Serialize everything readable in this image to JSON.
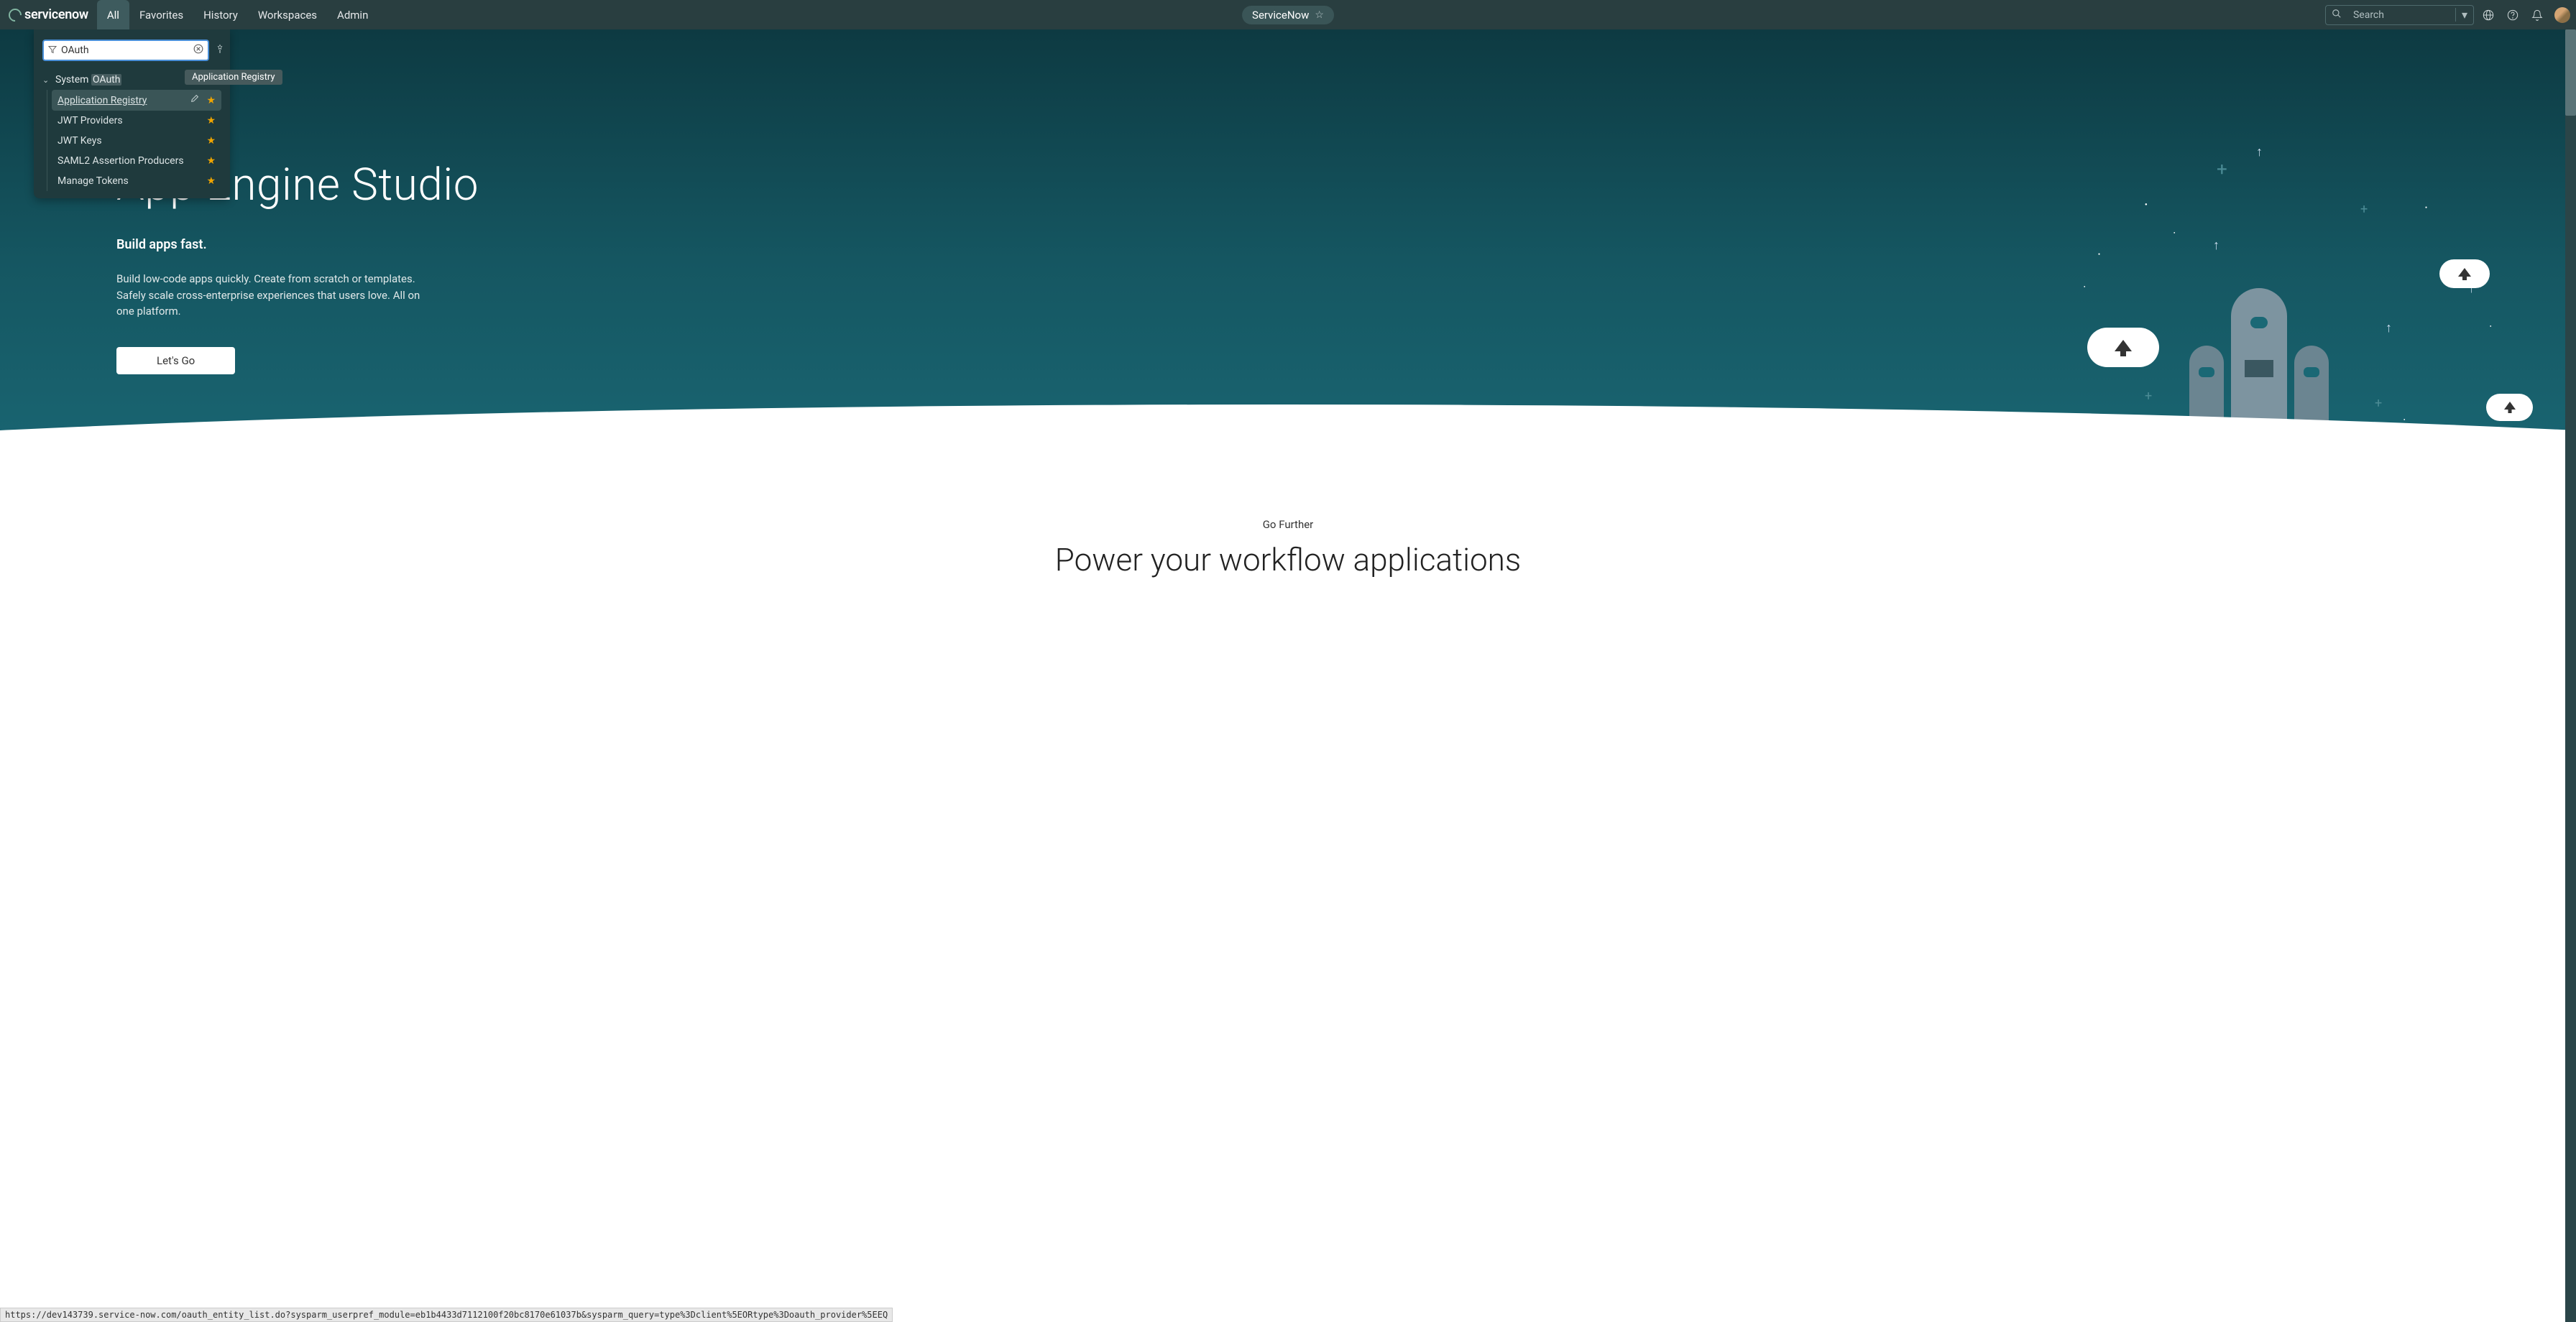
{
  "topbar": {
    "logo_text": "servicenow",
    "tabs": [
      "All",
      "Favorites",
      "History",
      "Workspaces",
      "Admin"
    ],
    "active_tab": 0,
    "center_label": "ServiceNow",
    "search_placeholder": "Search"
  },
  "filter_panel": {
    "input_value": "OAuth",
    "section_prefix": "System ",
    "section_highlight": "OAuth",
    "tooltip": "Application Registry",
    "items": [
      {
        "label": "Application Registry",
        "selected": true,
        "has_edit": true
      },
      {
        "label": "JWT Providers",
        "selected": false,
        "has_edit": false
      },
      {
        "label": "JWT Keys",
        "selected": false,
        "has_edit": false
      },
      {
        "label": "SAML2 Assertion Producers",
        "selected": false,
        "has_edit": false
      },
      {
        "label": "Manage Tokens",
        "selected": false,
        "has_edit": false
      }
    ]
  },
  "hero": {
    "title": "App Engine Studio",
    "subtitle": "Build apps fast.",
    "description": "Build low-code apps quickly. Create from scratch or templates. Safely scale cross-enterprise experiences that users love.\nAll on one platform.",
    "button": "Let's Go"
  },
  "below": {
    "go_further": "Go Further",
    "power_title": "Power your workflow applications"
  },
  "status_url": "https://dev143739.service-now.com/oauth_entity_list.do?sysparm_userpref_module=eb1b4433d7112100f20bc8170e61037b&sysparm_query=type%3Dclient%5EORtype%3Doauth_provider%5EEQ"
}
